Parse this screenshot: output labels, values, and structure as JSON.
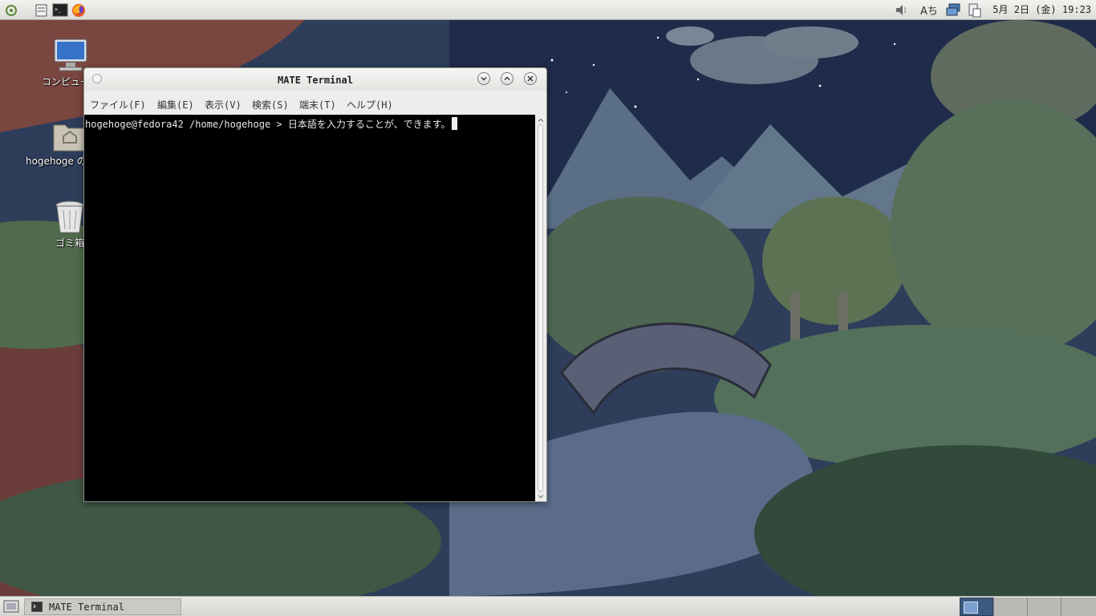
{
  "top_panel": {
    "clock": "5月 2日 (金) 19:23",
    "input_method_label": "Aち",
    "launchers": [
      "mate-menu-icon",
      "file-manager-icon",
      "terminal-icon",
      "firefox-icon"
    ]
  },
  "desktop": {
    "icons": [
      {
        "label": "コンピュータ",
        "icon": "computer-icon"
      },
      {
        "label": "hogehoge のホーム",
        "icon": "home-folder-icon"
      },
      {
        "label": "ゴミ箱",
        "icon": "trash-icon"
      }
    ]
  },
  "terminal": {
    "title": "MATE Terminal",
    "menu": [
      "ファイル(F)",
      "編集(E)",
      "表示(V)",
      "検索(S)",
      "端末(T)",
      "ヘルプ(H)"
    ],
    "prompt_line": "hogehoge@fedora42 /home/hogehoge > 日本語を入力することが、できます。"
  },
  "bottom_panel": {
    "task_label": "MATE Terminal"
  },
  "colors": {
    "terminal_bg": "#000000",
    "terminal_fg": "#e8e8e8",
    "panel_bg": "#e0e0dc",
    "workspace_active": "#3b5a7f"
  }
}
